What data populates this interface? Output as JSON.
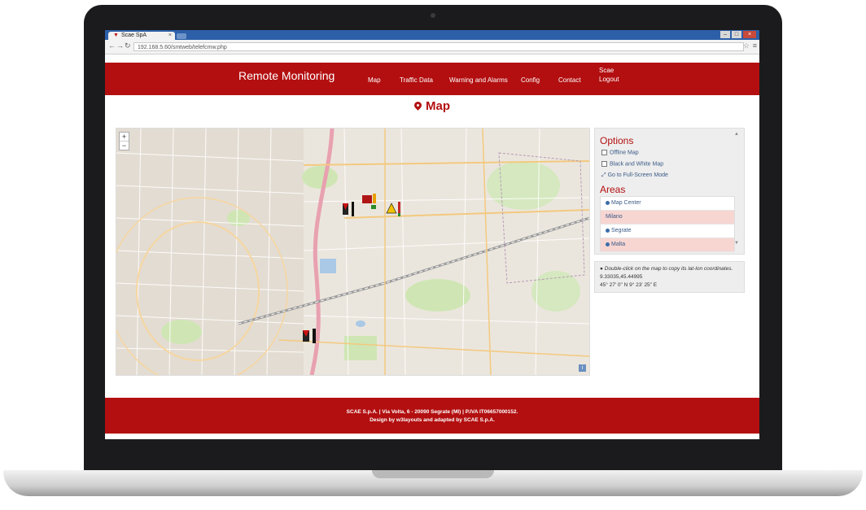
{
  "browser": {
    "tab_title": "Scae SpA",
    "url": "192.168.5.60/smtweb/telefcmw.php"
  },
  "header": {
    "brand": "Remote Monitoring",
    "nav": [
      "Map",
      "Traffic Data",
      "Warning and Alarms",
      "Config",
      "Contact"
    ],
    "user_name": "Scae",
    "logout": "Logout"
  },
  "page": {
    "title": "Map"
  },
  "map": {
    "zoom_in": "+",
    "zoom_out": "−"
  },
  "options": {
    "heading": "Options",
    "offline_map": "Offline Map",
    "bw_map": "Black and White Map",
    "fullscreen": "Go to Full-Screen Mode"
  },
  "areas": {
    "heading": "Areas",
    "items": [
      "Map Center",
      "Milano",
      "Segrate",
      "Malta"
    ]
  },
  "coords": {
    "hint": "Double-click on the map to copy its lat-lon coordinates.",
    "decimal": "9.33035,45.44995",
    "dms": "45° 27' 0\" N 9° 23' 25\" E"
  },
  "footer": {
    "line1": "SCAE S.p.A. | Via Volta, 6 - 20090 Segrate (MI) | P.IVA IT06657000152.",
    "line2": "Design by w3layouts and adapted by SCAE S.p.A."
  },
  "colors": {
    "brand_red": "#b30f10",
    "link_blue": "#3a5a86",
    "row_pink": "#f7d6d2"
  }
}
